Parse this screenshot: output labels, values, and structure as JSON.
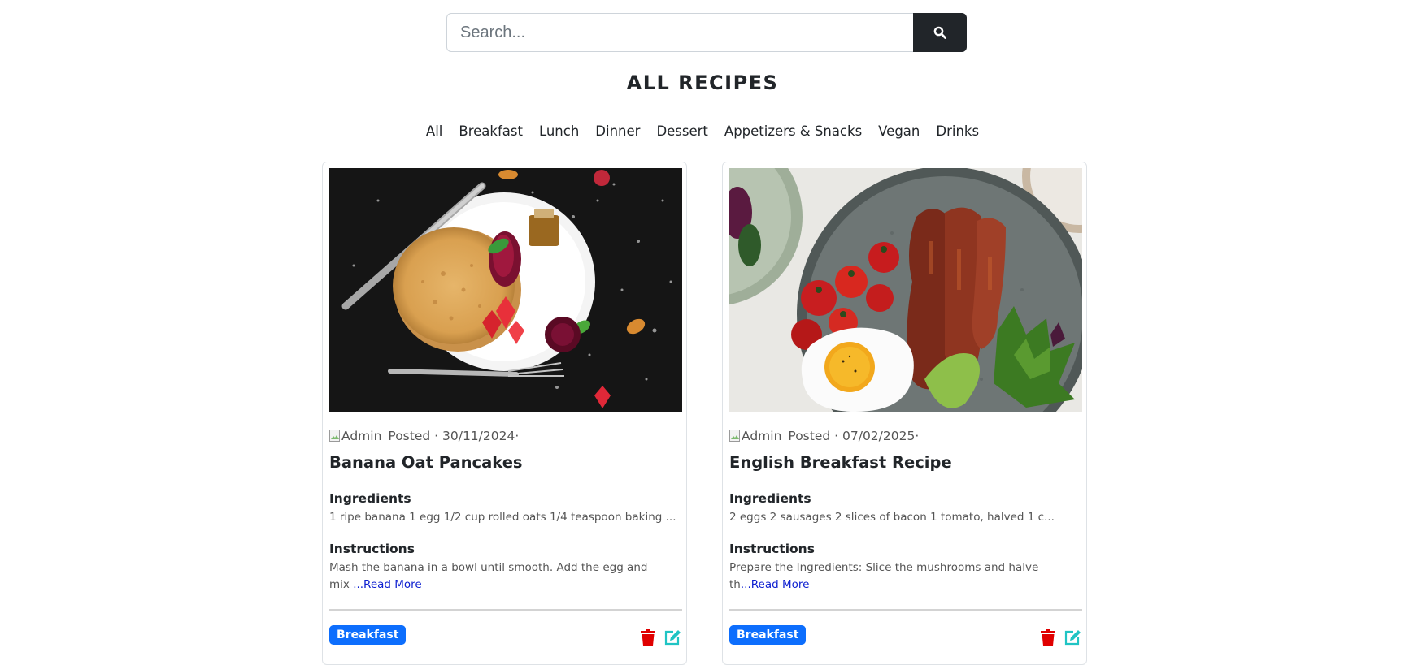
{
  "search": {
    "placeholder": "Search...",
    "icon": "search-icon"
  },
  "page": {
    "title": "ALL RECIPES"
  },
  "categories": [
    "All",
    "Breakfast",
    "Lunch",
    "Dinner",
    "Dessert",
    "Appetizers & Snacks",
    "Vegan",
    "Drinks"
  ],
  "recipes": [
    {
      "avatar_alt": "Admin",
      "posted_label": "Posted · 30/11/2024·",
      "title": "Banana Oat Pancakes",
      "ingredients_heading": "Ingredients",
      "ingredients": "1 ripe banana 1 egg 1/2 cup rolled oats 1/4 teaspoon baking ...",
      "instructions_heading": "Instructions",
      "instructions": "Mash the banana in a bowl until smooth. Add the egg and mix ",
      "read_more": "...Read More",
      "category": "Breakfast"
    },
    {
      "avatar_alt": "Admin",
      "posted_label": "Posted · 07/02/2025·",
      "title": "English Breakfast Recipe",
      "ingredients_heading": "Ingredients",
      "ingredients": "2 eggs 2 sausages 2 slices of bacon 1 tomato, halved 1 c...",
      "instructions_heading": "Instructions",
      "instructions": "Prepare the Ingredients: Slice the mushrooms and halve th",
      "read_more": "...Read More",
      "category": "Breakfast"
    }
  ],
  "colors": {
    "search_button": "#212529",
    "badge": "#0d6efd",
    "delete_icon": "#e00000",
    "edit_icon": "#20c4c4",
    "read_more": "#0d1fd0"
  }
}
